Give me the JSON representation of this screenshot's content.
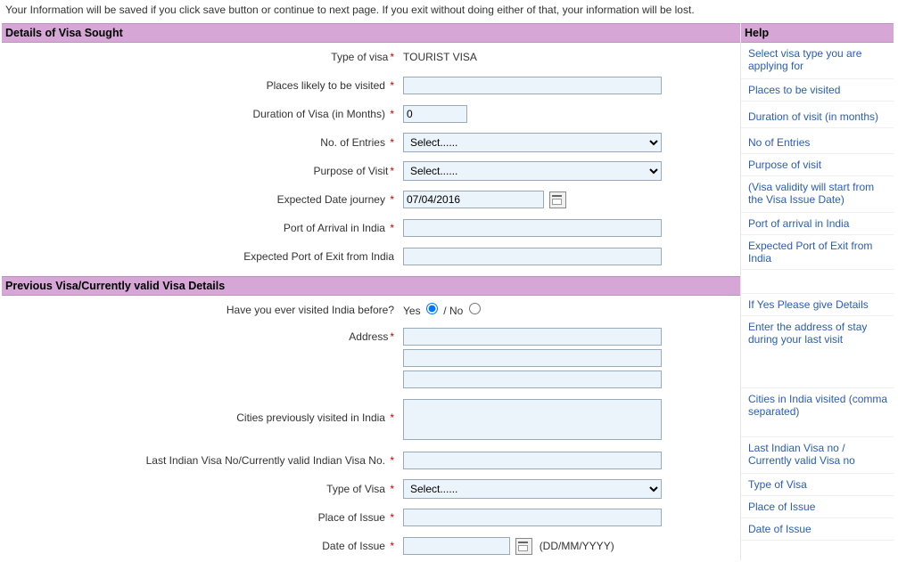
{
  "notice": "Your Information will be saved if you click save button or continue to next page. If you exit without doing either of that, your information will be lost.",
  "sections": {
    "visa_sought": "Details of Visa Sought",
    "prev_visa": "Previous Visa/Currently valid Visa Details"
  },
  "help_title": "Help",
  "labels": {
    "type_of_visa": "Type of visa",
    "places_visited": "Places likely to be visited",
    "duration": "Duration of Visa (in Months)",
    "entries": "No. of Entries",
    "purpose": "Purpose of Visit",
    "expected_date": "Expected Date journey",
    "port_arrival": "Port of Arrival in India",
    "port_exit": "Expected Port of Exit from India",
    "visited_before": "Have you ever visited India before?",
    "address": "Address",
    "cities_prev": "Cities previously visited in India",
    "last_visa_no": "Last Indian Visa No/Currently valid Indian Visa No.",
    "type_of_visa2": "Type of Visa",
    "place_issue": "Place of Issue",
    "date_issue": "Date of Issue"
  },
  "values": {
    "type_of_visa": "TOURIST VISA",
    "duration": "0",
    "expected_date": "07/04/2016",
    "select_placeholder": "Select......",
    "yes": "Yes",
    "no": "No",
    "slash": " / ",
    "date_fmt": "(DD/MM/YYYY)"
  },
  "help": {
    "type_of_visa": "Select visa type you are applying for",
    "places": "Places to be visited",
    "duration": "Duration of visit (in months)",
    "entries": "No of Entries",
    "purpose": "Purpose of visit",
    "expected_date": "(Visa validity will start from the Visa Issue Date)",
    "port_arrival": "Port of arrival in India",
    "port_exit": "Expected Port of Exit from India",
    "visited_before": "If Yes Please give Details",
    "address": "Enter the address of stay during your last visit",
    "cities_prev": "Cities in India visited (comma separated)",
    "last_visa_no": "Last Indian Visa no / Currently valid Visa no",
    "type_of_visa2": "Type of Visa",
    "place_issue": "Place of Issue",
    "date_issue": "Date of Issue"
  }
}
